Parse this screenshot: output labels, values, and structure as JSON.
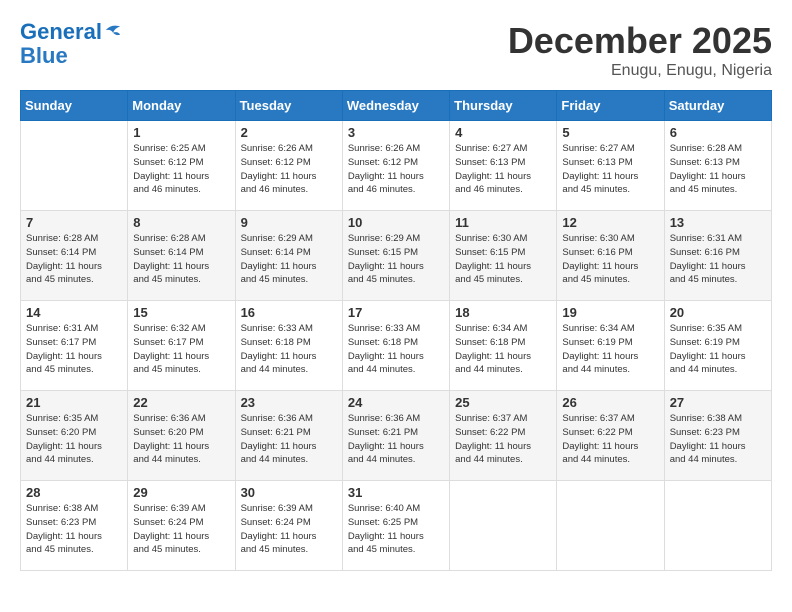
{
  "header": {
    "logo_line1": "General",
    "logo_line2": "Blue",
    "month": "December 2025",
    "location": "Enugu, Enugu, Nigeria"
  },
  "columns": [
    "Sunday",
    "Monday",
    "Tuesday",
    "Wednesday",
    "Thursday",
    "Friday",
    "Saturday"
  ],
  "weeks": [
    [
      {
        "day": "",
        "info": ""
      },
      {
        "day": "1",
        "info": "Sunrise: 6:25 AM\nSunset: 6:12 PM\nDaylight: 11 hours\nand 46 minutes."
      },
      {
        "day": "2",
        "info": "Sunrise: 6:26 AM\nSunset: 6:12 PM\nDaylight: 11 hours\nand 46 minutes."
      },
      {
        "day": "3",
        "info": "Sunrise: 6:26 AM\nSunset: 6:12 PM\nDaylight: 11 hours\nand 46 minutes."
      },
      {
        "day": "4",
        "info": "Sunrise: 6:27 AM\nSunset: 6:13 PM\nDaylight: 11 hours\nand 46 minutes."
      },
      {
        "day": "5",
        "info": "Sunrise: 6:27 AM\nSunset: 6:13 PM\nDaylight: 11 hours\nand 45 minutes."
      },
      {
        "day": "6",
        "info": "Sunrise: 6:28 AM\nSunset: 6:13 PM\nDaylight: 11 hours\nand 45 minutes."
      }
    ],
    [
      {
        "day": "7",
        "info": "Sunrise: 6:28 AM\nSunset: 6:14 PM\nDaylight: 11 hours\nand 45 minutes."
      },
      {
        "day": "8",
        "info": "Sunrise: 6:28 AM\nSunset: 6:14 PM\nDaylight: 11 hours\nand 45 minutes."
      },
      {
        "day": "9",
        "info": "Sunrise: 6:29 AM\nSunset: 6:14 PM\nDaylight: 11 hours\nand 45 minutes."
      },
      {
        "day": "10",
        "info": "Sunrise: 6:29 AM\nSunset: 6:15 PM\nDaylight: 11 hours\nand 45 minutes."
      },
      {
        "day": "11",
        "info": "Sunrise: 6:30 AM\nSunset: 6:15 PM\nDaylight: 11 hours\nand 45 minutes."
      },
      {
        "day": "12",
        "info": "Sunrise: 6:30 AM\nSunset: 6:16 PM\nDaylight: 11 hours\nand 45 minutes."
      },
      {
        "day": "13",
        "info": "Sunrise: 6:31 AM\nSunset: 6:16 PM\nDaylight: 11 hours\nand 45 minutes."
      }
    ],
    [
      {
        "day": "14",
        "info": "Sunrise: 6:31 AM\nSunset: 6:17 PM\nDaylight: 11 hours\nand 45 minutes."
      },
      {
        "day": "15",
        "info": "Sunrise: 6:32 AM\nSunset: 6:17 PM\nDaylight: 11 hours\nand 45 minutes."
      },
      {
        "day": "16",
        "info": "Sunrise: 6:33 AM\nSunset: 6:18 PM\nDaylight: 11 hours\nand 44 minutes."
      },
      {
        "day": "17",
        "info": "Sunrise: 6:33 AM\nSunset: 6:18 PM\nDaylight: 11 hours\nand 44 minutes."
      },
      {
        "day": "18",
        "info": "Sunrise: 6:34 AM\nSunset: 6:18 PM\nDaylight: 11 hours\nand 44 minutes."
      },
      {
        "day": "19",
        "info": "Sunrise: 6:34 AM\nSunset: 6:19 PM\nDaylight: 11 hours\nand 44 minutes."
      },
      {
        "day": "20",
        "info": "Sunrise: 6:35 AM\nSunset: 6:19 PM\nDaylight: 11 hours\nand 44 minutes."
      }
    ],
    [
      {
        "day": "21",
        "info": "Sunrise: 6:35 AM\nSunset: 6:20 PM\nDaylight: 11 hours\nand 44 minutes."
      },
      {
        "day": "22",
        "info": "Sunrise: 6:36 AM\nSunset: 6:20 PM\nDaylight: 11 hours\nand 44 minutes."
      },
      {
        "day": "23",
        "info": "Sunrise: 6:36 AM\nSunset: 6:21 PM\nDaylight: 11 hours\nand 44 minutes."
      },
      {
        "day": "24",
        "info": "Sunrise: 6:36 AM\nSunset: 6:21 PM\nDaylight: 11 hours\nand 44 minutes."
      },
      {
        "day": "25",
        "info": "Sunrise: 6:37 AM\nSunset: 6:22 PM\nDaylight: 11 hours\nand 44 minutes."
      },
      {
        "day": "26",
        "info": "Sunrise: 6:37 AM\nSunset: 6:22 PM\nDaylight: 11 hours\nand 44 minutes."
      },
      {
        "day": "27",
        "info": "Sunrise: 6:38 AM\nSunset: 6:23 PM\nDaylight: 11 hours\nand 44 minutes."
      }
    ],
    [
      {
        "day": "28",
        "info": "Sunrise: 6:38 AM\nSunset: 6:23 PM\nDaylight: 11 hours\nand 45 minutes."
      },
      {
        "day": "29",
        "info": "Sunrise: 6:39 AM\nSunset: 6:24 PM\nDaylight: 11 hours\nand 45 minutes."
      },
      {
        "day": "30",
        "info": "Sunrise: 6:39 AM\nSunset: 6:24 PM\nDaylight: 11 hours\nand 45 minutes."
      },
      {
        "day": "31",
        "info": "Sunrise: 6:40 AM\nSunset: 6:25 PM\nDaylight: 11 hours\nand 45 minutes."
      },
      {
        "day": "",
        "info": ""
      },
      {
        "day": "",
        "info": ""
      },
      {
        "day": "",
        "info": ""
      }
    ]
  ]
}
